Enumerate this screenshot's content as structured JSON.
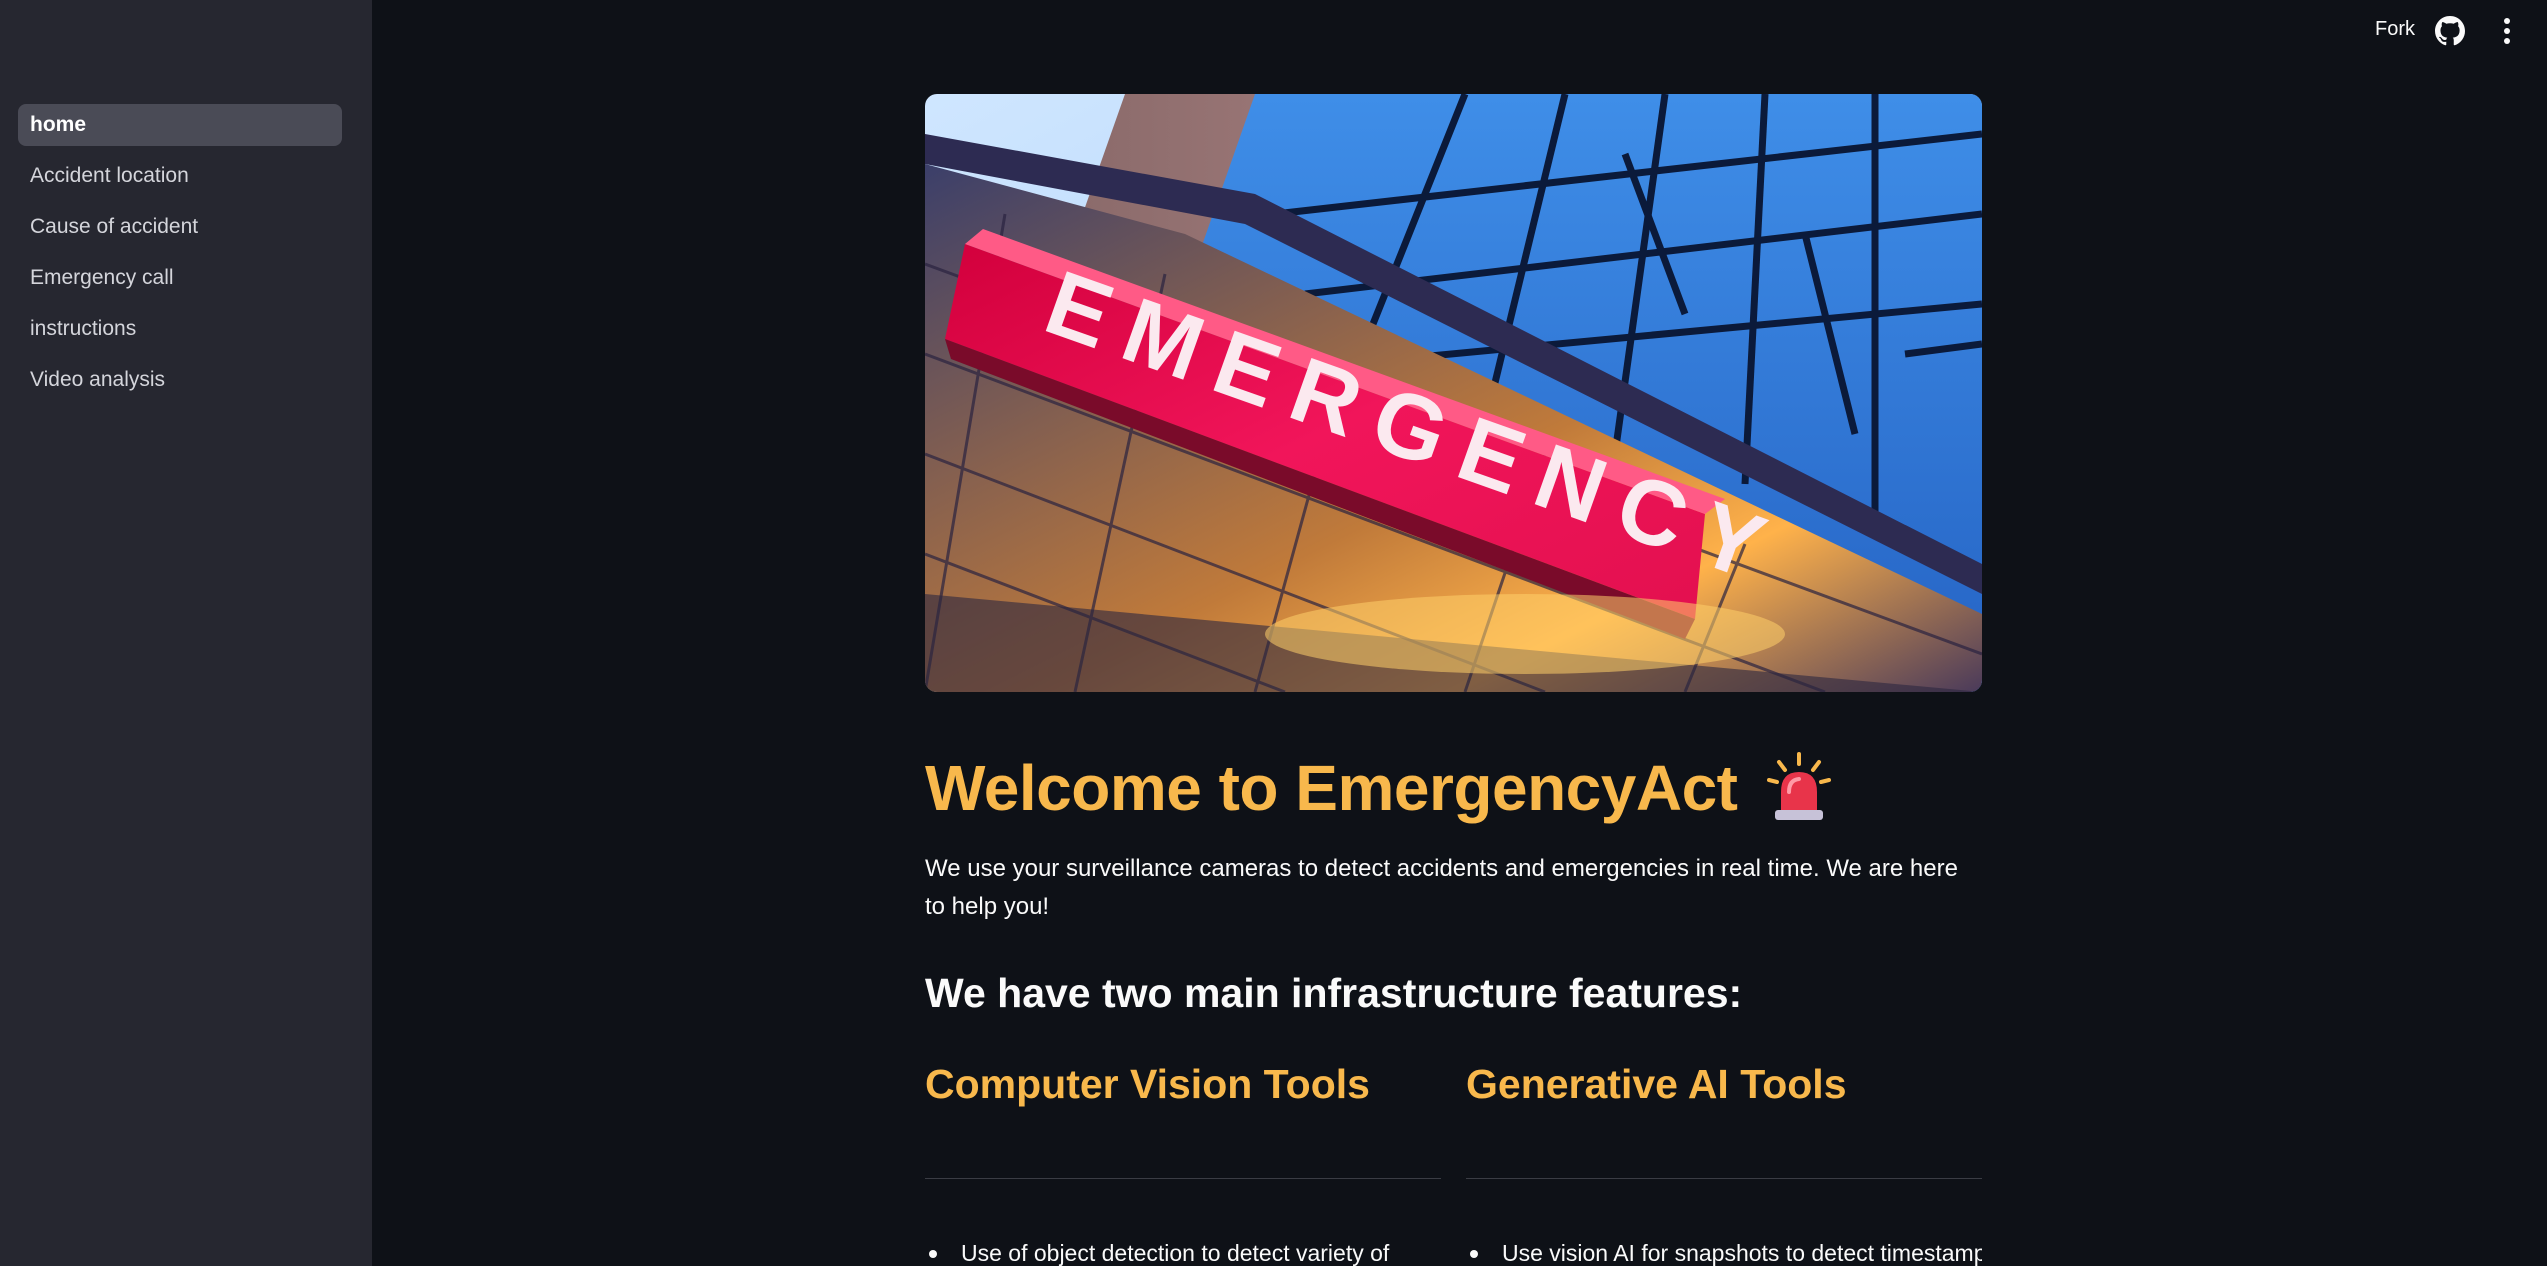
{
  "sidebar": {
    "items": [
      {
        "label": "home",
        "active": true
      },
      {
        "label": "Accident location"
      },
      {
        "label": "Cause of accident"
      },
      {
        "label": "Emergency call"
      },
      {
        "label": "instructions"
      },
      {
        "label": "Video analysis"
      }
    ]
  },
  "header": {
    "fork_label": "Fork",
    "github_icon": "github-icon",
    "menu_icon": "more-vertical-icon"
  },
  "hero": {
    "sign_text": "EMERGENCY"
  },
  "main": {
    "title": "Welcome to EmergencyAct",
    "title_icon": "siren-icon",
    "intro": "We use your surveillance cameras to detect accidents and emergencies in real time. We are here to help you!",
    "features_heading": "We have two main infrastructure features:",
    "columns": [
      {
        "title": "Computer Vision Tools",
        "items": [
          "Use of object detection to detect variety of"
        ]
      },
      {
        "title": "Generative AI Tools",
        "items": [
          "Use vision AI for snapshots to detect timestamp"
        ]
      }
    ]
  },
  "colors": {
    "background": "#0e1117",
    "sidebar": "#262730",
    "accent": "#f8b84c",
    "text": "#fafafa"
  }
}
